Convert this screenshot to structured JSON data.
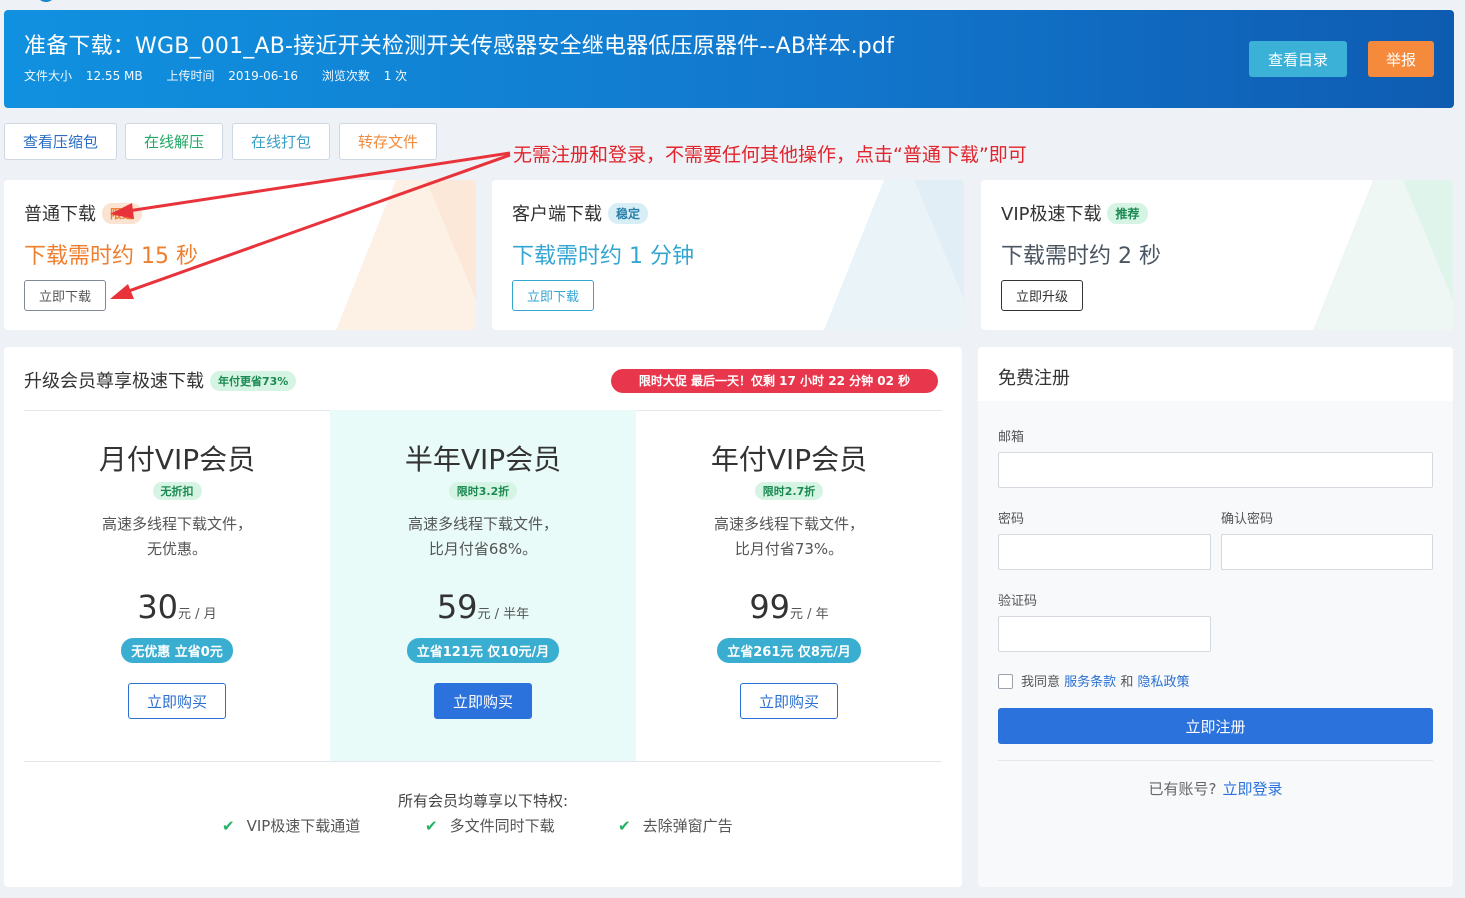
{
  "header": {
    "title": "准备下载：WGB_001_AB-接近开关检测开关传感器安全继电器低压原器件--AB样本.pdf",
    "size_label": "文件大小",
    "size_value": "12.55 MB",
    "upload_label": "上传时间",
    "upload_value": "2019-06-16",
    "views_label": "浏览次数",
    "views_value": "1 次",
    "catalog_btn": "查看目录",
    "report_btn": "举报"
  },
  "tools": [
    {
      "label": "查看压缩包",
      "color": "#2a6cc4"
    },
    {
      "label": "在线解压",
      "color": "#24a866"
    },
    {
      "label": "在线打包",
      "color": "#3a9fc4"
    },
    {
      "label": "转存文件",
      "color": "#f08a3c"
    }
  ],
  "annotation": "无需注册和登录，不需要任何其他操作，点击“普通下载”即可",
  "download_cards": [
    {
      "name": "普通下载",
      "badge": "限速",
      "time": "下载需时约 15 秒",
      "button": "立即下载",
      "time_color": "#ef7f2f"
    },
    {
      "name": "客户端下载",
      "badge": "稳定",
      "time": "下载需时约 1 分钟",
      "button": "立即下载",
      "time_color": "#33a6d2"
    },
    {
      "name": "VIP极速下载",
      "badge": "推荐",
      "time": "下载需时约 2 秒",
      "button": "立即升级",
      "time_color": "#4a5562"
    }
  ],
  "vip": {
    "title": "升级会员尊享极速下载",
    "title_badge": "年付更省73%",
    "promo": "限时大促 最后一天！仅剩 17 小时 22 分钟 02 秒",
    "plans": [
      {
        "name": "月付VIP会员",
        "tag": "无折扣",
        "desc1": "高速多线程下载文件，",
        "desc2": "无优惠。",
        "price": "30",
        "unit": "元 / 月",
        "save": "无优惠 立省0元",
        "buy": "立即购买"
      },
      {
        "name": "半年VIP会员",
        "tag": "限时3.2折",
        "desc1": "高速多线程下载文件，",
        "desc2": "比月付省68%。",
        "price": "59",
        "unit": "元 / 半年",
        "save": "立省121元 仅10元/月",
        "buy": "立即购买"
      },
      {
        "name": "年付VIP会员",
        "tag": "限时2.7折",
        "desc1": "高速多线程下载文件，",
        "desc2": "比月付省73%。",
        "price": "99",
        "unit": "元 / 年",
        "save": "立省261元 仅8元/月",
        "buy": "立即购买"
      }
    ],
    "perks_title": "所有会员均尊享以下特权:",
    "perks": [
      "VIP极速下载通道",
      "多文件同时下载",
      "去除弹窗广告"
    ],
    "highlight_color": "#e8fbf9"
  },
  "register": {
    "title": "免费注册",
    "email_label": "邮箱",
    "password_label": "密码",
    "confirm_label": "确认密码",
    "captcha_label": "验证码",
    "agree_prefix": "我同意",
    "terms": "服务条款",
    "and": "和",
    "privacy": "隐私政策",
    "submit": "立即注册",
    "have_account": "已有账号?",
    "login": "立即登录"
  }
}
